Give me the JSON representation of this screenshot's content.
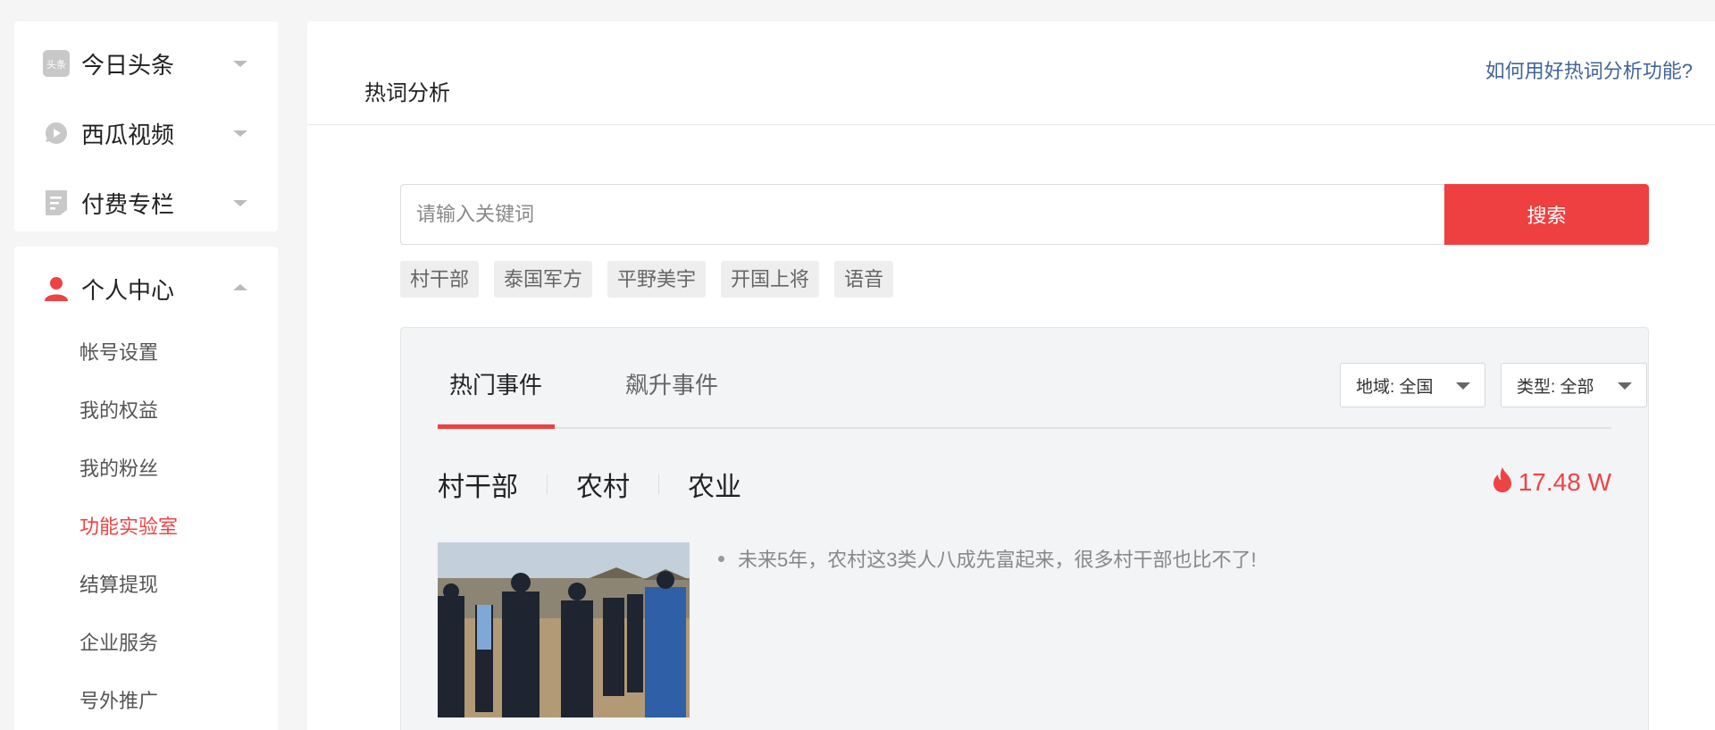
{
  "sidebar": {
    "platforms": [
      {
        "label": "今日头条",
        "icon": "toutiao-icon",
        "expanded": false
      },
      {
        "label": "西瓜视频",
        "icon": "xigua-video-icon",
        "expanded": false
      },
      {
        "label": "付费专栏",
        "icon": "paid-column-icon",
        "expanded": false
      }
    ],
    "personal": {
      "label": "个人中心",
      "icon": "user-icon",
      "expanded": true,
      "items": [
        {
          "label": "帐号设置",
          "active": false
        },
        {
          "label": "我的权益",
          "active": false
        },
        {
          "label": "我的粉丝",
          "active": false
        },
        {
          "label": "功能实验室",
          "active": true
        },
        {
          "label": "结算提现",
          "active": false
        },
        {
          "label": "企业服务",
          "active": false
        },
        {
          "label": "号外推广",
          "active": false
        }
      ]
    },
    "toutiao_badge": "头条"
  },
  "main": {
    "title": "热词分析",
    "help_link": "如何用好热词分析功能?",
    "search": {
      "placeholder": "请输入关键词",
      "value": "",
      "button_label": "搜索"
    },
    "suggested_tags": [
      "村干部",
      "泰国军方",
      "平野美宇",
      "开国上将",
      "语音"
    ],
    "tabs": [
      {
        "label": "热门事件",
        "active": true
      },
      {
        "label": "飙升事件",
        "active": false
      }
    ],
    "filters": {
      "region": "地域: 全国",
      "type": "类型: 全部"
    },
    "event": {
      "keywords": [
        "村干部",
        "农村",
        "农业"
      ],
      "heat": "17.48 W",
      "heat_icon": "flame-icon",
      "news": [
        "未来5年，农村这3类人八成先富起来，很多村干部也比不了!"
      ]
    }
  },
  "colors": {
    "accent": "#ee4040",
    "link": "#406599",
    "active_nav": "#ee4343"
  }
}
